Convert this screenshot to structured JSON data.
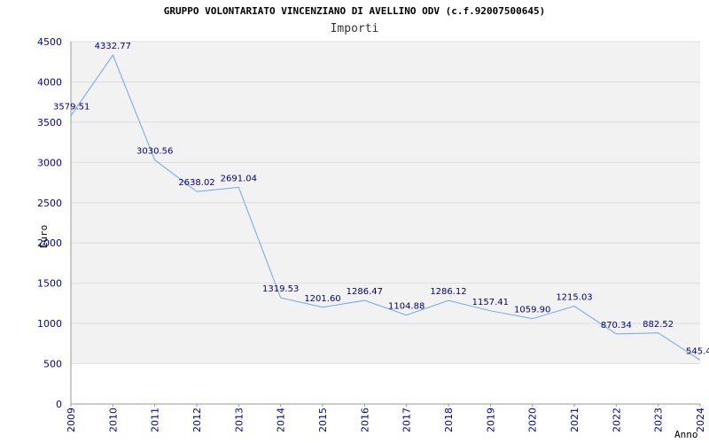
{
  "chart_data": {
    "type": "line",
    "title": "GRUPPO VOLONTARIATO VINCENZIANO DI AVELLINO ODV (c.f.92007500645)",
    "subtitle": "Importi",
    "xlabel": "Anno",
    "ylabel": "Euro",
    "x": [
      "2009",
      "2010",
      "2011",
      "2012",
      "2013",
      "2014",
      "2015",
      "2016",
      "2017",
      "2018",
      "2019",
      "2020",
      "2021",
      "2022",
      "2023",
      "2024"
    ],
    "series": [
      {
        "values": [
          3579.51,
          4332.77,
          3030.56,
          2638.02,
          2691.04,
          1319.53,
          1201.6,
          1286.47,
          1104.88,
          1286.12,
          1157.41,
          1059.9,
          1215.03,
          870.34,
          882.52,
          545.4
        ],
        "labels": [
          "3579.51",
          "4332.77",
          "3030.56",
          "2638.02",
          "2691.04",
          "1319.53",
          "1201.60",
          "1286.47",
          "1104.88",
          "1286.12",
          "1157.41",
          "1059.90",
          "1215.03",
          "870.34",
          "882.52",
          "545.4"
        ]
      }
    ],
    "ylim": [
      0,
      4500
    ],
    "yticks": [
      "0",
      "500",
      "1000",
      "1500",
      "2000",
      "2500",
      "3000",
      "3500",
      "4000",
      "4500"
    ],
    "grid": "horizontal alternating bands",
    "colors": {
      "line": "#6aa8e8",
      "ticks": "#0000aa",
      "band": "#f2f2f2",
      "gridline": "#dddddd",
      "axis": "#999999"
    }
  }
}
